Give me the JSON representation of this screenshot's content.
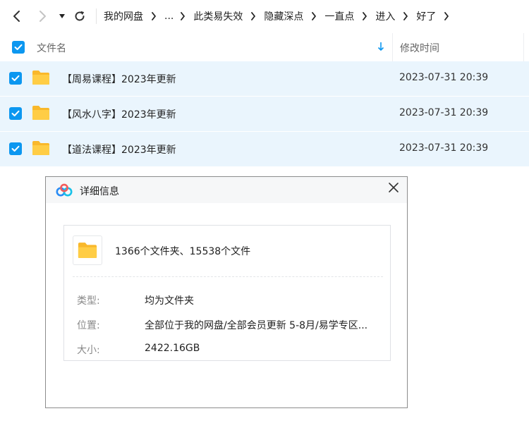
{
  "nav": {
    "back_icon": "chevron-left-icon",
    "forward_icon": "chevron-right-icon",
    "dropdown_icon": "caret-down-icon",
    "refresh_icon": "refresh-icon"
  },
  "breadcrumb": [
    "我的网盘",
    "...",
    "此类易失效",
    "隐藏深点",
    "一直点",
    "进入",
    "好了"
  ],
  "list_header": {
    "name": "文件名",
    "modified": "修改时间",
    "sort_icon": "sort-down-arrow-icon"
  },
  "files": [
    {
      "name": "【周易课程】2023年更新",
      "modified": "2023-07-31 20:39",
      "checked": true
    },
    {
      "name": "【风水八字】2023年更新",
      "modified": "2023-07-31 20:39",
      "checked": true
    },
    {
      "name": "【道法课程】2023年更新",
      "modified": "2023-07-31 20:39",
      "checked": true
    }
  ],
  "dialog": {
    "title": "详细信息",
    "logo_icon": "baidu-netdisk-logo-icon",
    "close_icon": "close-icon",
    "summary": "1366个文件夹、15538个文件",
    "type_label": "类型:",
    "type_value": "均为文件夹",
    "location_label": "位置:",
    "location_value": "全部位于我的网盘/全部会员更新 5-8月/易学专区...",
    "size_label": "大小:",
    "size_value": "2422.16GB"
  },
  "colors": {
    "accent": "#0c97f0",
    "selected_row": "#eaf5fd",
    "folder": "#ffc933"
  }
}
